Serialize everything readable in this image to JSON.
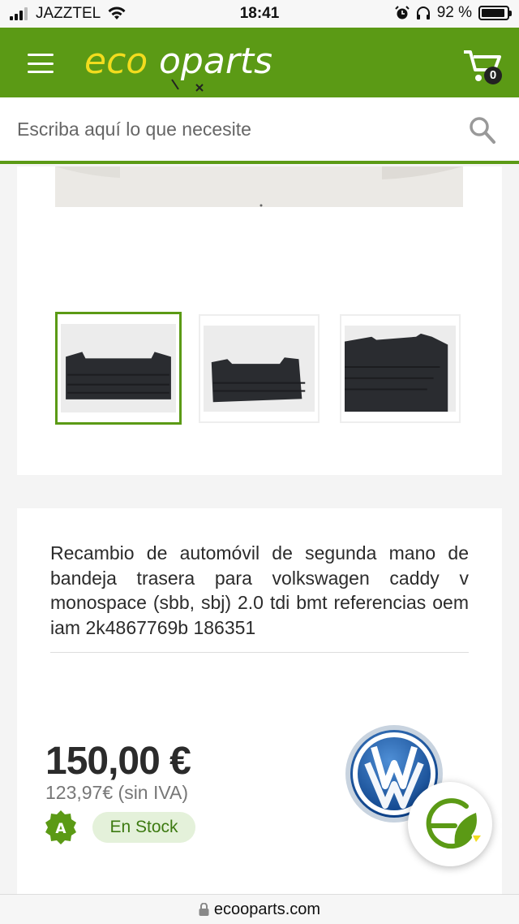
{
  "status_bar": {
    "carrier": "JAZZTEL",
    "time": "18:41",
    "battery": "92 %",
    "icons": [
      "signal-icon",
      "wifi-icon",
      "alarm-icon",
      "headphones-icon",
      "battery-icon"
    ]
  },
  "header": {
    "logo_text": "ecooparts",
    "cart_count": "0",
    "icons": [
      "menu-icon",
      "cart-icon"
    ],
    "colors": {
      "brand_green": "#5b9a15",
      "logo_yellow": "#f2dc1e"
    }
  },
  "search": {
    "placeholder": "Escriba aquí lo que necesite",
    "icon": "search-icon"
  },
  "gallery": {
    "thumbnails": [
      "thumbnail-1",
      "thumbnail-2",
      "thumbnail-3"
    ],
    "selected_index": 0
  },
  "product": {
    "title": "Recambio de automóvil de segunda mano de bandeja trasera para volkswagen caddy v monospace (sbb, sbj) 2.0 tdi bmt referencias oem iam 2k4867769b 186351",
    "price": "150,00 €",
    "price_without_vat": "123,97€ (sin IVA)",
    "grade_badge": "A",
    "stock_label": "En Stock",
    "brand_icon": "volkswagen-logo",
    "fab_icon": "ecooparts-eco-icon"
  },
  "browser": {
    "url": "ecooparts.com",
    "icon": "lock-icon"
  }
}
